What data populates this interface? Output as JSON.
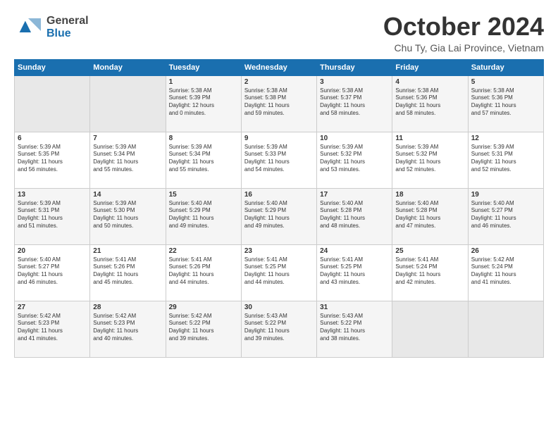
{
  "header": {
    "logo_line1": "General",
    "logo_line2": "Blue",
    "title": "October 2024",
    "subtitle": "Chu Ty, Gia Lai Province, Vietnam"
  },
  "weekdays": [
    "Sunday",
    "Monday",
    "Tuesday",
    "Wednesday",
    "Thursday",
    "Friday",
    "Saturday"
  ],
  "weeks": [
    [
      {
        "day": "",
        "content": ""
      },
      {
        "day": "",
        "content": ""
      },
      {
        "day": "1",
        "content": "Sunrise: 5:38 AM\nSunset: 5:39 PM\nDaylight: 12 hours\nand 0 minutes."
      },
      {
        "day": "2",
        "content": "Sunrise: 5:38 AM\nSunset: 5:38 PM\nDaylight: 11 hours\nand 59 minutes."
      },
      {
        "day": "3",
        "content": "Sunrise: 5:38 AM\nSunset: 5:37 PM\nDaylight: 11 hours\nand 58 minutes."
      },
      {
        "day": "4",
        "content": "Sunrise: 5:38 AM\nSunset: 5:36 PM\nDaylight: 11 hours\nand 58 minutes."
      },
      {
        "day": "5",
        "content": "Sunrise: 5:38 AM\nSunset: 5:36 PM\nDaylight: 11 hours\nand 57 minutes."
      }
    ],
    [
      {
        "day": "6",
        "content": "Sunrise: 5:39 AM\nSunset: 5:35 PM\nDaylight: 11 hours\nand 56 minutes."
      },
      {
        "day": "7",
        "content": "Sunrise: 5:39 AM\nSunset: 5:34 PM\nDaylight: 11 hours\nand 55 minutes."
      },
      {
        "day": "8",
        "content": "Sunrise: 5:39 AM\nSunset: 5:34 PM\nDaylight: 11 hours\nand 55 minutes."
      },
      {
        "day": "9",
        "content": "Sunrise: 5:39 AM\nSunset: 5:33 PM\nDaylight: 11 hours\nand 54 minutes."
      },
      {
        "day": "10",
        "content": "Sunrise: 5:39 AM\nSunset: 5:32 PM\nDaylight: 11 hours\nand 53 minutes."
      },
      {
        "day": "11",
        "content": "Sunrise: 5:39 AM\nSunset: 5:32 PM\nDaylight: 11 hours\nand 52 minutes."
      },
      {
        "day": "12",
        "content": "Sunrise: 5:39 AM\nSunset: 5:31 PM\nDaylight: 11 hours\nand 52 minutes."
      }
    ],
    [
      {
        "day": "13",
        "content": "Sunrise: 5:39 AM\nSunset: 5:31 PM\nDaylight: 11 hours\nand 51 minutes."
      },
      {
        "day": "14",
        "content": "Sunrise: 5:39 AM\nSunset: 5:30 PM\nDaylight: 11 hours\nand 50 minutes."
      },
      {
        "day": "15",
        "content": "Sunrise: 5:40 AM\nSunset: 5:29 PM\nDaylight: 11 hours\nand 49 minutes."
      },
      {
        "day": "16",
        "content": "Sunrise: 5:40 AM\nSunset: 5:29 PM\nDaylight: 11 hours\nand 49 minutes."
      },
      {
        "day": "17",
        "content": "Sunrise: 5:40 AM\nSunset: 5:28 PM\nDaylight: 11 hours\nand 48 minutes."
      },
      {
        "day": "18",
        "content": "Sunrise: 5:40 AM\nSunset: 5:28 PM\nDaylight: 11 hours\nand 47 minutes."
      },
      {
        "day": "19",
        "content": "Sunrise: 5:40 AM\nSunset: 5:27 PM\nDaylight: 11 hours\nand 46 minutes."
      }
    ],
    [
      {
        "day": "20",
        "content": "Sunrise: 5:40 AM\nSunset: 5:27 PM\nDaylight: 11 hours\nand 46 minutes."
      },
      {
        "day": "21",
        "content": "Sunrise: 5:41 AM\nSunset: 5:26 PM\nDaylight: 11 hours\nand 45 minutes."
      },
      {
        "day": "22",
        "content": "Sunrise: 5:41 AM\nSunset: 5:26 PM\nDaylight: 11 hours\nand 44 minutes."
      },
      {
        "day": "23",
        "content": "Sunrise: 5:41 AM\nSunset: 5:25 PM\nDaylight: 11 hours\nand 44 minutes."
      },
      {
        "day": "24",
        "content": "Sunrise: 5:41 AM\nSunset: 5:25 PM\nDaylight: 11 hours\nand 43 minutes."
      },
      {
        "day": "25",
        "content": "Sunrise: 5:41 AM\nSunset: 5:24 PM\nDaylight: 11 hours\nand 42 minutes."
      },
      {
        "day": "26",
        "content": "Sunrise: 5:42 AM\nSunset: 5:24 PM\nDaylight: 11 hours\nand 41 minutes."
      }
    ],
    [
      {
        "day": "27",
        "content": "Sunrise: 5:42 AM\nSunset: 5:23 PM\nDaylight: 11 hours\nand 41 minutes."
      },
      {
        "day": "28",
        "content": "Sunrise: 5:42 AM\nSunset: 5:23 PM\nDaylight: 11 hours\nand 40 minutes."
      },
      {
        "day": "29",
        "content": "Sunrise: 5:42 AM\nSunset: 5:22 PM\nDaylight: 11 hours\nand 39 minutes."
      },
      {
        "day": "30",
        "content": "Sunrise: 5:43 AM\nSunset: 5:22 PM\nDaylight: 11 hours\nand 39 minutes."
      },
      {
        "day": "31",
        "content": "Sunrise: 5:43 AM\nSunset: 5:22 PM\nDaylight: 11 hours\nand 38 minutes."
      },
      {
        "day": "",
        "content": ""
      },
      {
        "day": "",
        "content": ""
      }
    ]
  ],
  "colors": {
    "header_bg": "#1a6faf",
    "header_text": "#ffffff",
    "accent": "#1a6faf"
  }
}
